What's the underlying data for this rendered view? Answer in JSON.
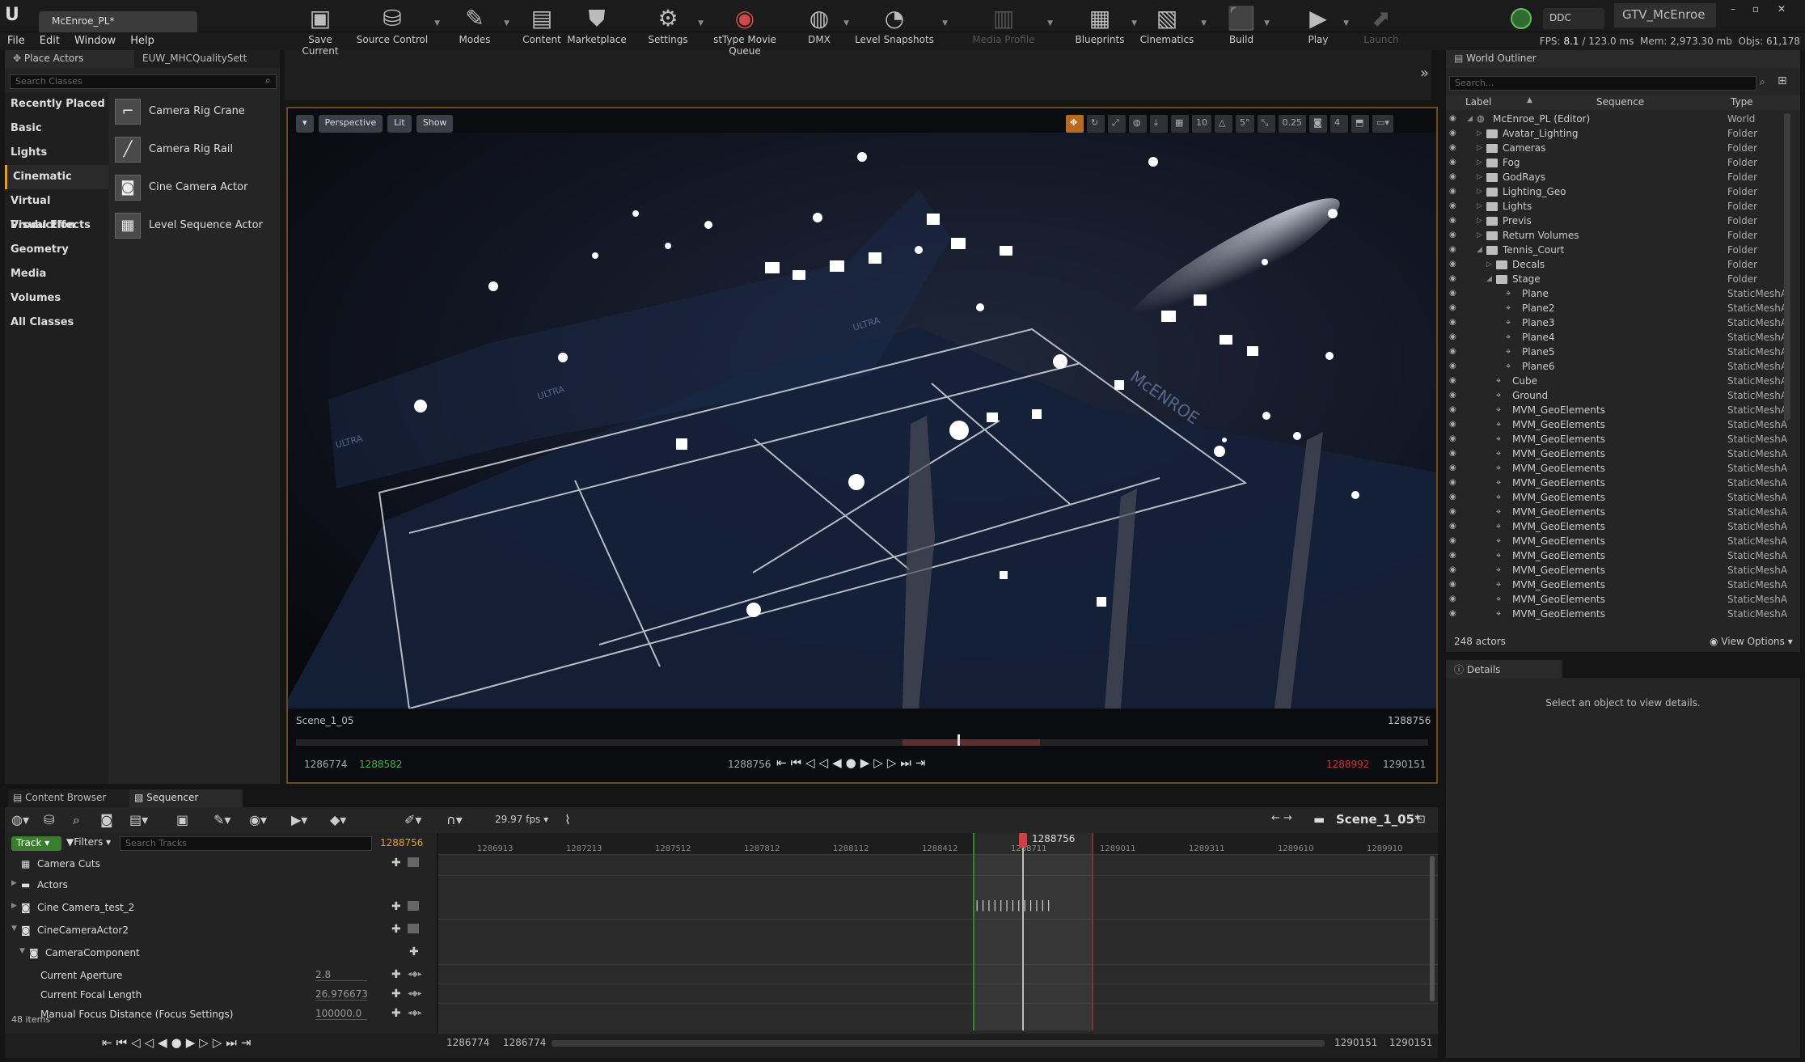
{
  "window": {
    "logo": "U",
    "doc_tab": "McEnroe_PL*",
    "ddc": "DDC",
    "project": "GTV_McEnroe",
    "minimize": "–",
    "maximize": "▫",
    "close": "✕"
  },
  "menu": [
    "File",
    "Edit",
    "Window",
    "Help"
  ],
  "stats": {
    "fps_label": "FPS:",
    "fps": "8.1",
    "ms": "123.0 ms",
    "mem_label": "Mem:",
    "mem": "2,973.30 mb",
    "objs_label": "Objs:",
    "objs": "61,178"
  },
  "place_actors": {
    "tab": "Place Actors",
    "other_tab": "EUW_MHCQualitySett",
    "search_placeholder": "Search Classes",
    "categories": [
      "Recently Placed",
      "Basic",
      "Lights",
      "Cinematic",
      "Virtual Production",
      "Visual Effects",
      "Geometry",
      "Media",
      "Volumes",
      "All Classes"
    ],
    "selected_category": "Cinematic",
    "items": [
      "Camera Rig Crane",
      "Camera Rig Rail",
      "Cine Camera Actor",
      "Level Sequence Actor"
    ]
  },
  "toolbar": [
    {
      "label": "Save Current",
      "icon": "save-icon"
    },
    {
      "label": "Source Control",
      "icon": "source-control-icon"
    },
    {
      "label": "Modes",
      "icon": "modes-icon"
    },
    {
      "label": "Content",
      "icon": "content-icon"
    },
    {
      "label": "Marketplace",
      "icon": "marketplace-icon"
    },
    {
      "label": "Settings",
      "icon": "settings-icon"
    },
    {
      "label": "stType Movie Queue",
      "icon": "movie-queue-icon"
    },
    {
      "label": "DMX",
      "icon": "dmx-icon"
    },
    {
      "label": "Level Snapshots",
      "icon": "level-snapshots-icon"
    },
    {
      "label": "Media Profile",
      "icon": "media-profile-icon"
    },
    {
      "label": "Blueprints",
      "icon": "blueprints-icon"
    },
    {
      "label": "Cinematics",
      "icon": "cinematics-icon"
    },
    {
      "label": "Build",
      "icon": "build-icon"
    },
    {
      "label": "Play",
      "icon": "play-icon"
    },
    {
      "label": "Launch",
      "icon": "launch-icon"
    }
  ],
  "viewport": {
    "perspective": "Perspective",
    "lit": "Lit",
    "show": "Show",
    "grid_snap": "10",
    "rot_snap": "5°",
    "scale_snap": "0.25",
    "cam_speed": "4",
    "scene_label": "Scene_1_05",
    "frame_right": "1288756",
    "tc_start": "1286774",
    "tc_in": "1288582",
    "tc_current": "1288756",
    "tc_out": "1288992",
    "tc_end": "1290151"
  },
  "outliner": {
    "tab": "World Outliner",
    "search_placeholder": "Search...",
    "col_label": "Label",
    "col_sequence": "Sequence",
    "col_type": "Type",
    "rows": [
      {
        "label": "McEnroe_PL (Editor)",
        "type": "World",
        "kind": "world",
        "indent": 0
      },
      {
        "label": "Avatar_Lighting",
        "type": "Folder",
        "kind": "folder",
        "indent": 1
      },
      {
        "label": "Cameras",
        "type": "Folder",
        "kind": "folder",
        "indent": 1
      },
      {
        "label": "Fog",
        "type": "Folder",
        "kind": "folder",
        "indent": 1
      },
      {
        "label": "GodRays",
        "type": "Folder",
        "kind": "folder",
        "indent": 1
      },
      {
        "label": "Lighting_Geo",
        "type": "Folder",
        "kind": "folder",
        "indent": 1
      },
      {
        "label": "Lights",
        "type": "Folder",
        "kind": "folder",
        "indent": 1
      },
      {
        "label": "Previs",
        "type": "Folder",
        "kind": "folder",
        "indent": 1
      },
      {
        "label": "Return Volumes",
        "type": "Folder",
        "kind": "folder",
        "indent": 1
      },
      {
        "label": "Tennis_Court",
        "type": "Folder",
        "kind": "folder",
        "indent": 1
      },
      {
        "label": "Decals",
        "type": "Folder",
        "kind": "folder",
        "indent": 2
      },
      {
        "label": "Stage",
        "type": "Folder",
        "kind": "folder",
        "indent": 2
      },
      {
        "label": "Plane",
        "type": "StaticMeshA",
        "kind": "mesh",
        "indent": 3
      },
      {
        "label": "Plane2",
        "type": "StaticMeshA",
        "kind": "mesh",
        "indent": 3
      },
      {
        "label": "Plane3",
        "type": "StaticMeshA",
        "kind": "mesh",
        "indent": 3
      },
      {
        "label": "Plane4",
        "type": "StaticMeshA",
        "kind": "mesh",
        "indent": 3
      },
      {
        "label": "Plane5",
        "type": "StaticMeshA",
        "kind": "mesh",
        "indent": 3
      },
      {
        "label": "Plane6",
        "type": "StaticMeshA",
        "kind": "mesh",
        "indent": 3
      },
      {
        "label": "Cube",
        "type": "StaticMeshA",
        "kind": "mesh",
        "indent": 2
      },
      {
        "label": "Ground",
        "type": "StaticMeshA",
        "kind": "mesh",
        "indent": 2
      },
      {
        "label": "MVM_GeoElements",
        "type": "StaticMeshA",
        "kind": "mesh",
        "indent": 2
      },
      {
        "label": "MVM_GeoElements",
        "type": "StaticMeshA",
        "kind": "mesh",
        "indent": 2
      },
      {
        "label": "MVM_GeoElements",
        "type": "StaticMeshA",
        "kind": "mesh",
        "indent": 2
      },
      {
        "label": "MVM_GeoElements",
        "type": "StaticMeshA",
        "kind": "mesh",
        "indent": 2
      },
      {
        "label": "MVM_GeoElements",
        "type": "StaticMeshA",
        "kind": "mesh",
        "indent": 2
      },
      {
        "label": "MVM_GeoElements",
        "type": "StaticMeshA",
        "kind": "mesh",
        "indent": 2
      },
      {
        "label": "MVM_GeoElements",
        "type": "StaticMeshA",
        "kind": "mesh",
        "indent": 2
      },
      {
        "label": "MVM_GeoElements",
        "type": "StaticMeshA",
        "kind": "mesh",
        "indent": 2
      },
      {
        "label": "MVM_GeoElements",
        "type": "StaticMeshA",
        "kind": "mesh",
        "indent": 2
      },
      {
        "label": "MVM_GeoElements",
        "type": "StaticMeshA",
        "kind": "mesh",
        "indent": 2
      },
      {
        "label": "MVM_GeoElements",
        "type": "StaticMeshA",
        "kind": "mesh",
        "indent": 2
      },
      {
        "label": "MVM_GeoElements",
        "type": "StaticMeshA",
        "kind": "mesh",
        "indent": 2
      },
      {
        "label": "MVM_GeoElements",
        "type": "StaticMeshA",
        "kind": "mesh",
        "indent": 2
      },
      {
        "label": "MVM_GeoElements",
        "type": "StaticMeshA",
        "kind": "mesh",
        "indent": 2
      },
      {
        "label": "MVM_GeoElements",
        "type": "StaticMeshA",
        "kind": "mesh",
        "indent": 2
      }
    ],
    "actor_count": "248 actors",
    "view_options": "View Options"
  },
  "details": {
    "tab": "Details",
    "empty_message": "Select an object to view details."
  },
  "bottom_tabs": {
    "content_browser": "Content Browser",
    "sequencer": "Sequencer"
  },
  "sequencer": {
    "fps": "29.97 fps",
    "sequence_name": "Scene_1_05*",
    "track_button": "Track",
    "filters": "Filters",
    "search_placeholder": "Search Tracks",
    "current_frame": "1288756",
    "tracks": [
      {
        "label": "Camera Cuts",
        "indent": 0
      },
      {
        "label": "Actors",
        "indent": 0
      },
      {
        "label": "Cine Camera_test_2",
        "indent": 0
      },
      {
        "label": "CineCameraActor2",
        "indent": 0
      },
      {
        "label": "CameraComponent",
        "indent": 1
      }
    ],
    "properties": [
      {
        "label": "Current Aperture",
        "value": "2.8"
      },
      {
        "label": "Current Focal Length",
        "value": "26.976673"
      },
      {
        "label": "Manual Focus Distance (Focus Settings)",
        "value": "100000.0"
      }
    ],
    "item_count": "48 items",
    "ruler_ticks": [
      "1286913",
      "1287213",
      "1287512",
      "1287812",
      "1288112",
      "1288412",
      "1288711",
      "1289011",
      "1289311",
      "1289610",
      "1289910"
    ],
    "playhead_label": "1288756",
    "view_start": "1286774",
    "view_in": "1286774",
    "view_out": "1290151",
    "view_end": "1290151"
  }
}
